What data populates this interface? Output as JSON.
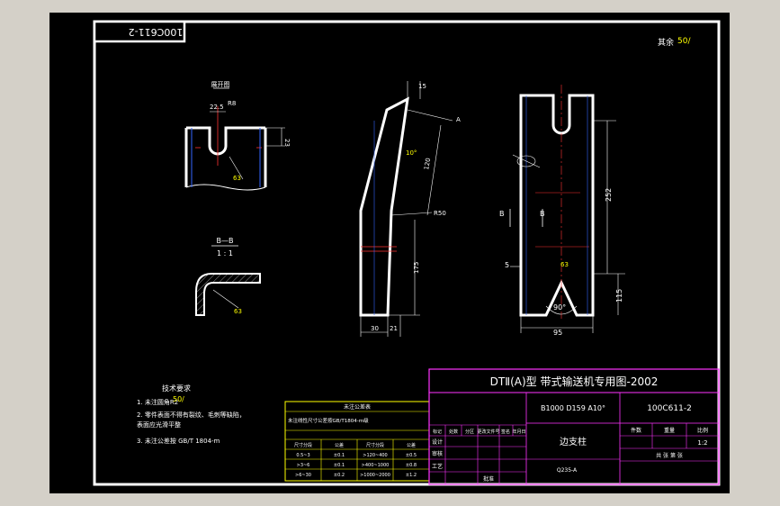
{
  "drawing_no_corner": "100C611-2",
  "surface_note": {
    "label": "其余",
    "value": "50/"
  },
  "view_labels": {
    "top_view": "展开图",
    "section_view": "B—B",
    "section_scale": "1 : 1",
    "section_marker": "B"
  },
  "dimensions": {
    "slot_width": "22.5",
    "slot_radius": "R8",
    "slot_depth": "23",
    "thickness": "15",
    "arm_length": "120",
    "bend_radius": "R50",
    "lower_length": "175",
    "base_width": "30",
    "base_offset": "21",
    "side_height": "252",
    "bottom_height": "115",
    "total_width": "95",
    "small_dim": "5",
    "angle": "90°",
    "angle_arm": "10°",
    "datum": "A"
  },
  "tech_req": {
    "title": "技术要求",
    "lines": [
      "1. 未注圆角R2",
      "2. 零件表面不得有裂纹、毛刺等缺陷，",
      "   表面应光滑平整",
      "3. 未注公差按 GB/T 1804-m"
    ],
    "surface_mark": "50/"
  },
  "title_block": {
    "main_title": "DTⅡ(A)型  带式输送机专用图-2002",
    "spec": "B1000 D159 A10°",
    "drawing_no": "100C611-2",
    "part_name": "边支柱",
    "material": "Q235-A",
    "scale": "1:2",
    "scale_label": "比例",
    "weight_label": "重量",
    "qty_label": "件数",
    "sheet_label": "共  张  第  张",
    "design_label": "设计",
    "check_label": "审核",
    "process_label": "工艺",
    "approve_label": "批准",
    "mark_headers": [
      "标记",
      "处数",
      "分区",
      "更改文件号",
      "签名",
      "年月日"
    ]
  },
  "tolerance_table": {
    "title": "未注公差表",
    "note": "未注线性尺寸公差按GB/T1804-m级",
    "headers": [
      "尺寸分段",
      "公差",
      "尺寸分段",
      "公差"
    ],
    "rows": [
      [
        "0.5~3",
        "±0.1",
        ">120~400",
        "±0.5"
      ],
      [
        ">3~6",
        "±0.1",
        ">400~1000",
        "±0.8"
      ],
      [
        ">6~30",
        "±0.2",
        ">1000~2000",
        "±1.2"
      ],
      [
        ">30~120",
        "±0.3",
        "",
        ""
      ]
    ]
  }
}
